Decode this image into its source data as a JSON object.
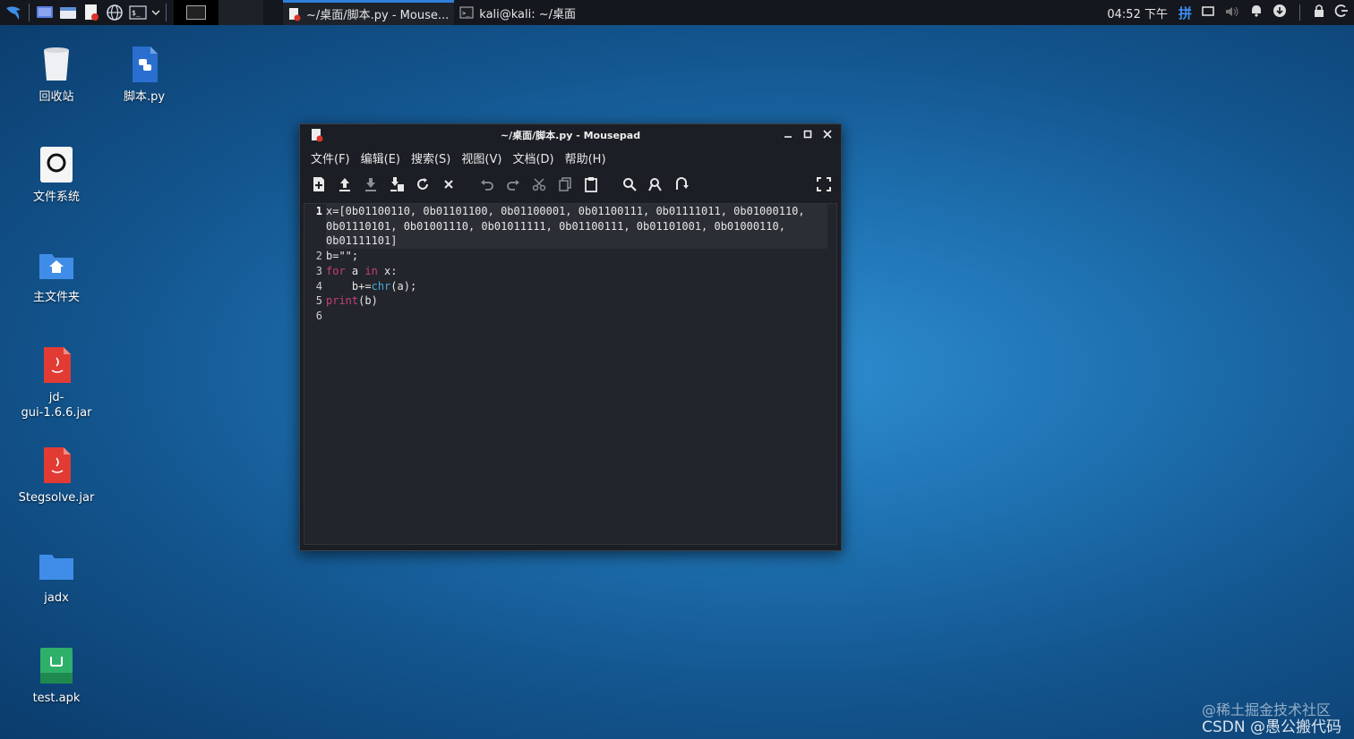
{
  "panel": {
    "clock": "04:52 下午",
    "ime": "拼",
    "tasks": [
      {
        "label": "~/桌面/脚本.py - Mouse...",
        "icon": "mousepad-icon"
      },
      {
        "label": "kali@kali: ~/桌面",
        "icon": "terminal-icon"
      }
    ]
  },
  "desktop": {
    "icons": [
      {
        "label": "回收站",
        "icon": "trash-icon"
      },
      {
        "label": "脚本.py",
        "icon": "python-file-icon"
      },
      {
        "label": "文件系统",
        "icon": "filesystem-icon"
      },
      {
        "label": "主文件夹",
        "icon": "home-folder-icon"
      },
      {
        "label": "jd-gui-1.6.6.jar",
        "label_line1": "jd-",
        "label_line2": "gui-1.6.6.jar",
        "icon": "java-jar-icon"
      },
      {
        "label": "Stegsolve.jar",
        "icon": "java-jar-icon"
      },
      {
        "label": "jadx",
        "icon": "folder-icon"
      },
      {
        "label": "test.apk",
        "icon": "android-apk-icon"
      }
    ]
  },
  "window": {
    "title": "~/桌面/脚本.py - Mousepad",
    "menu": [
      "文件(F)",
      "编辑(E)",
      "搜索(S)",
      "视图(V)",
      "文档(D)",
      "帮助(H)"
    ],
    "code_lines": [
      {
        "num": "1",
        "text": "x=[0b01100110, 0b01101100, 0b01100001, 0b01100111, 0b01111011, 0b01000110, 0b01110101, 0b01001110, 0b01011111, 0b01100111, 0b01101001, 0b01000110, 0b01111101]"
      },
      {
        "num": "2",
        "text": "b=\"\";"
      },
      {
        "num": "3",
        "kw1": "for",
        "mid1": " a ",
        "kw2": "in",
        "mid2": " x:"
      },
      {
        "num": "4",
        "pre": "    b+=",
        "fn": "chr",
        "post": "(a);"
      },
      {
        "num": "5",
        "kw": "print",
        "post": "(b)"
      },
      {
        "num": "6",
        "text": ""
      }
    ]
  },
  "watermark": {
    "line1": "@稀土掘金技术社区",
    "line2": "CSDN @愚公搬代码"
  },
  "colors": {
    "accent": "#2f7fd8",
    "keyword": "#c93f7a",
    "builtin": "#4aa8d8"
  }
}
